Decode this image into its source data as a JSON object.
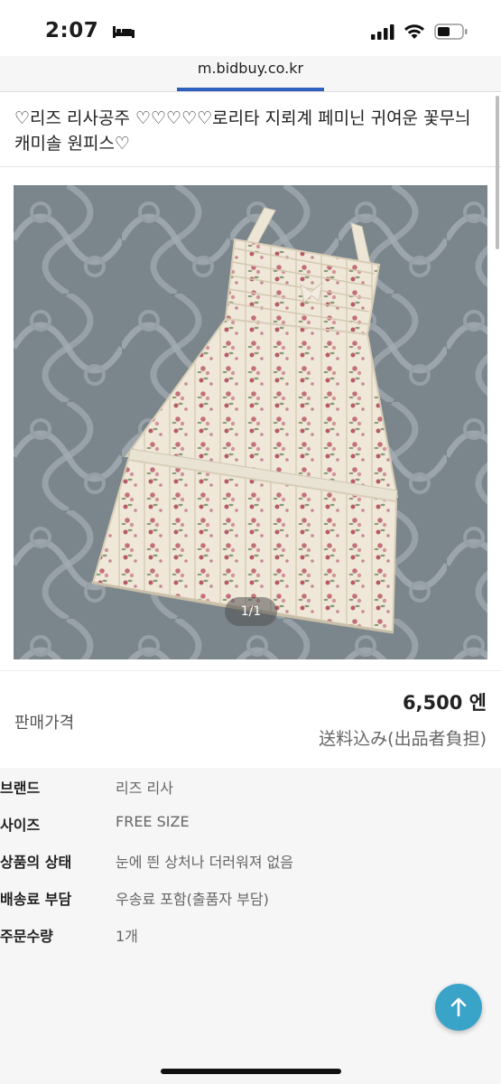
{
  "status_bar": {
    "time": "2:07"
  },
  "browser": {
    "url": "m.bidbuy.co.kr"
  },
  "product": {
    "title": "♡리즈 리사공주 ♡♡♡♡♡로리타 지뢰계 페미닌 귀여운 꽃무늬 캐미솔 원피스♡",
    "image_counter": "1/1",
    "price_label": "판매가격",
    "price": "6,500 엔",
    "shipping_note": "送料込み(出品者負担)"
  },
  "details": [
    {
      "key": "브랜드",
      "value": "리즈 리사"
    },
    {
      "key": "사이즈",
      "value": "FREE SIZE"
    },
    {
      "key": "상품의 상태",
      "value": "눈에 띈 상처나 더러워져 없음"
    },
    {
      "key": "배송료 부담",
      "value": "우송료 포함(출품자 부담)"
    },
    {
      "key": "주문수량",
      "value": "1개"
    }
  ],
  "icons": {
    "bed": "bed-icon",
    "signal": "signal-icon",
    "wifi": "wifi-icon",
    "battery": "battery-icon",
    "scroll_top": "arrow-up-icon"
  },
  "colors": {
    "accent": "#3aa3c8",
    "load_bar": "#2f5fbf"
  }
}
